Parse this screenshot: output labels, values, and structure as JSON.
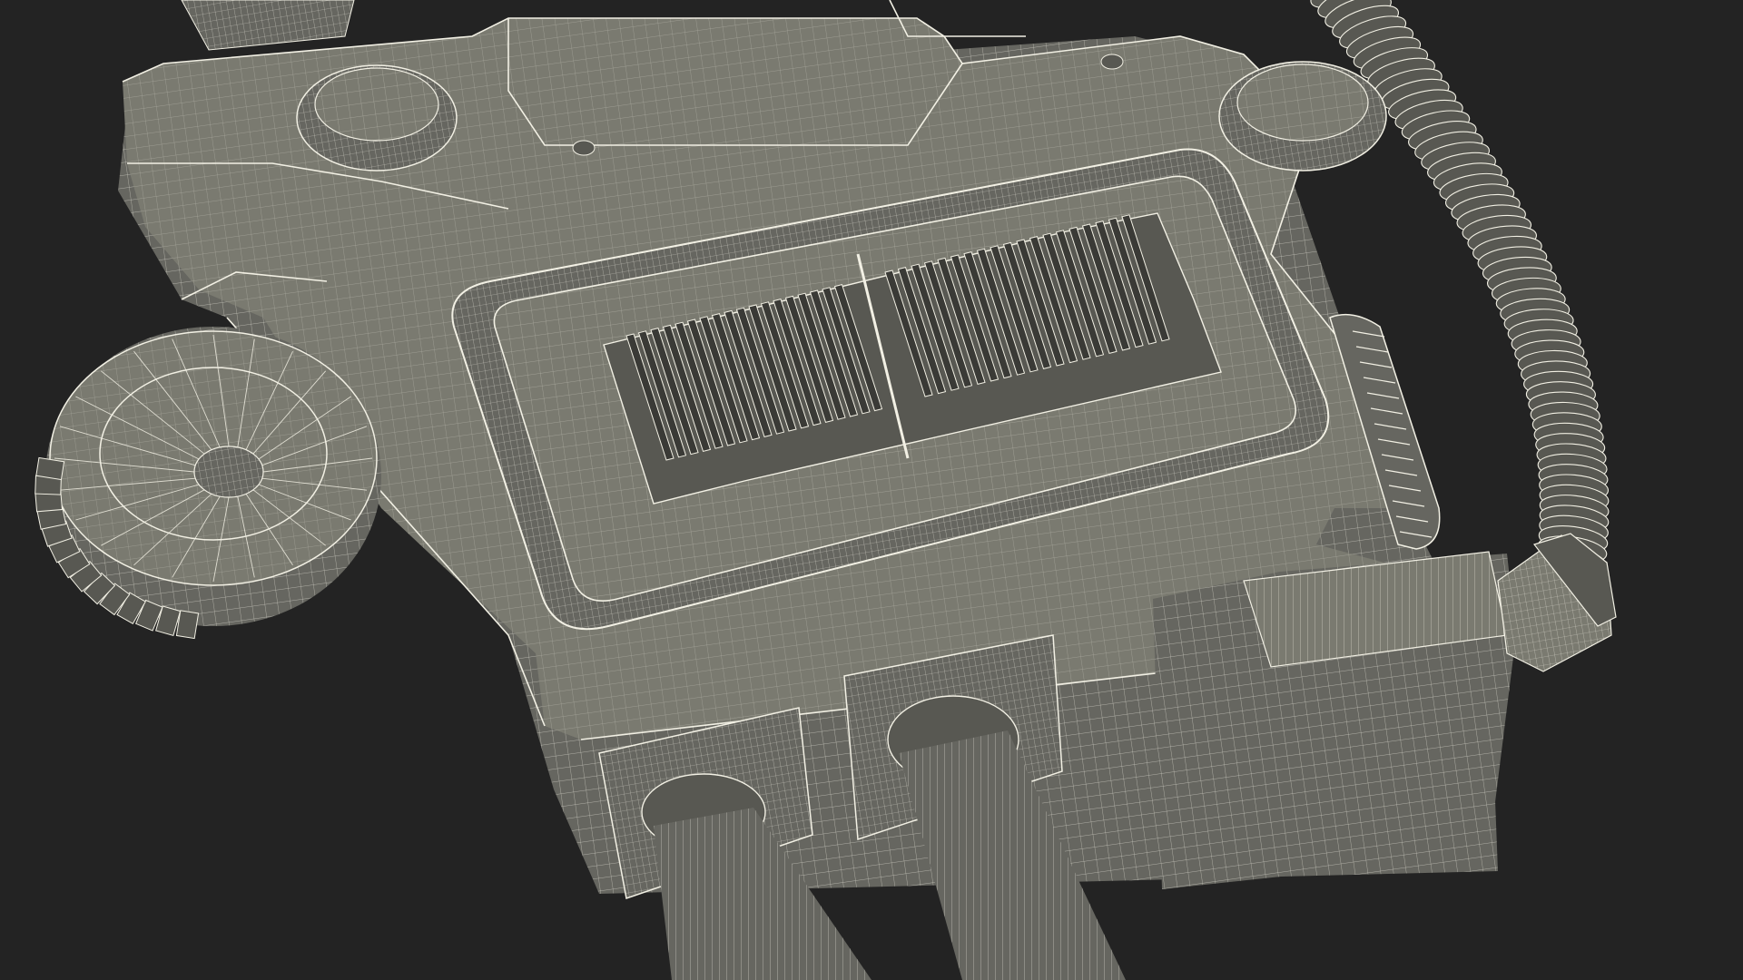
{
  "viewport": {
    "background_color": "#232323"
  },
  "model": {
    "surface_color": "#7a7a70",
    "surface_shade_color": "#666660",
    "surface_dark_color": "#585852",
    "wire_color": "#f2f0e4",
    "slot_color": "#3a3a36",
    "parts": [
      "housing",
      "left-dial",
      "top-mount-ring",
      "right-mount-ring",
      "vent-grille",
      "side-thumbwheel",
      "coiled-cable",
      "cable-plug",
      "rear-connector-block",
      "connector-left",
      "connector-right",
      "cable-left",
      "cable-right"
    ]
  }
}
